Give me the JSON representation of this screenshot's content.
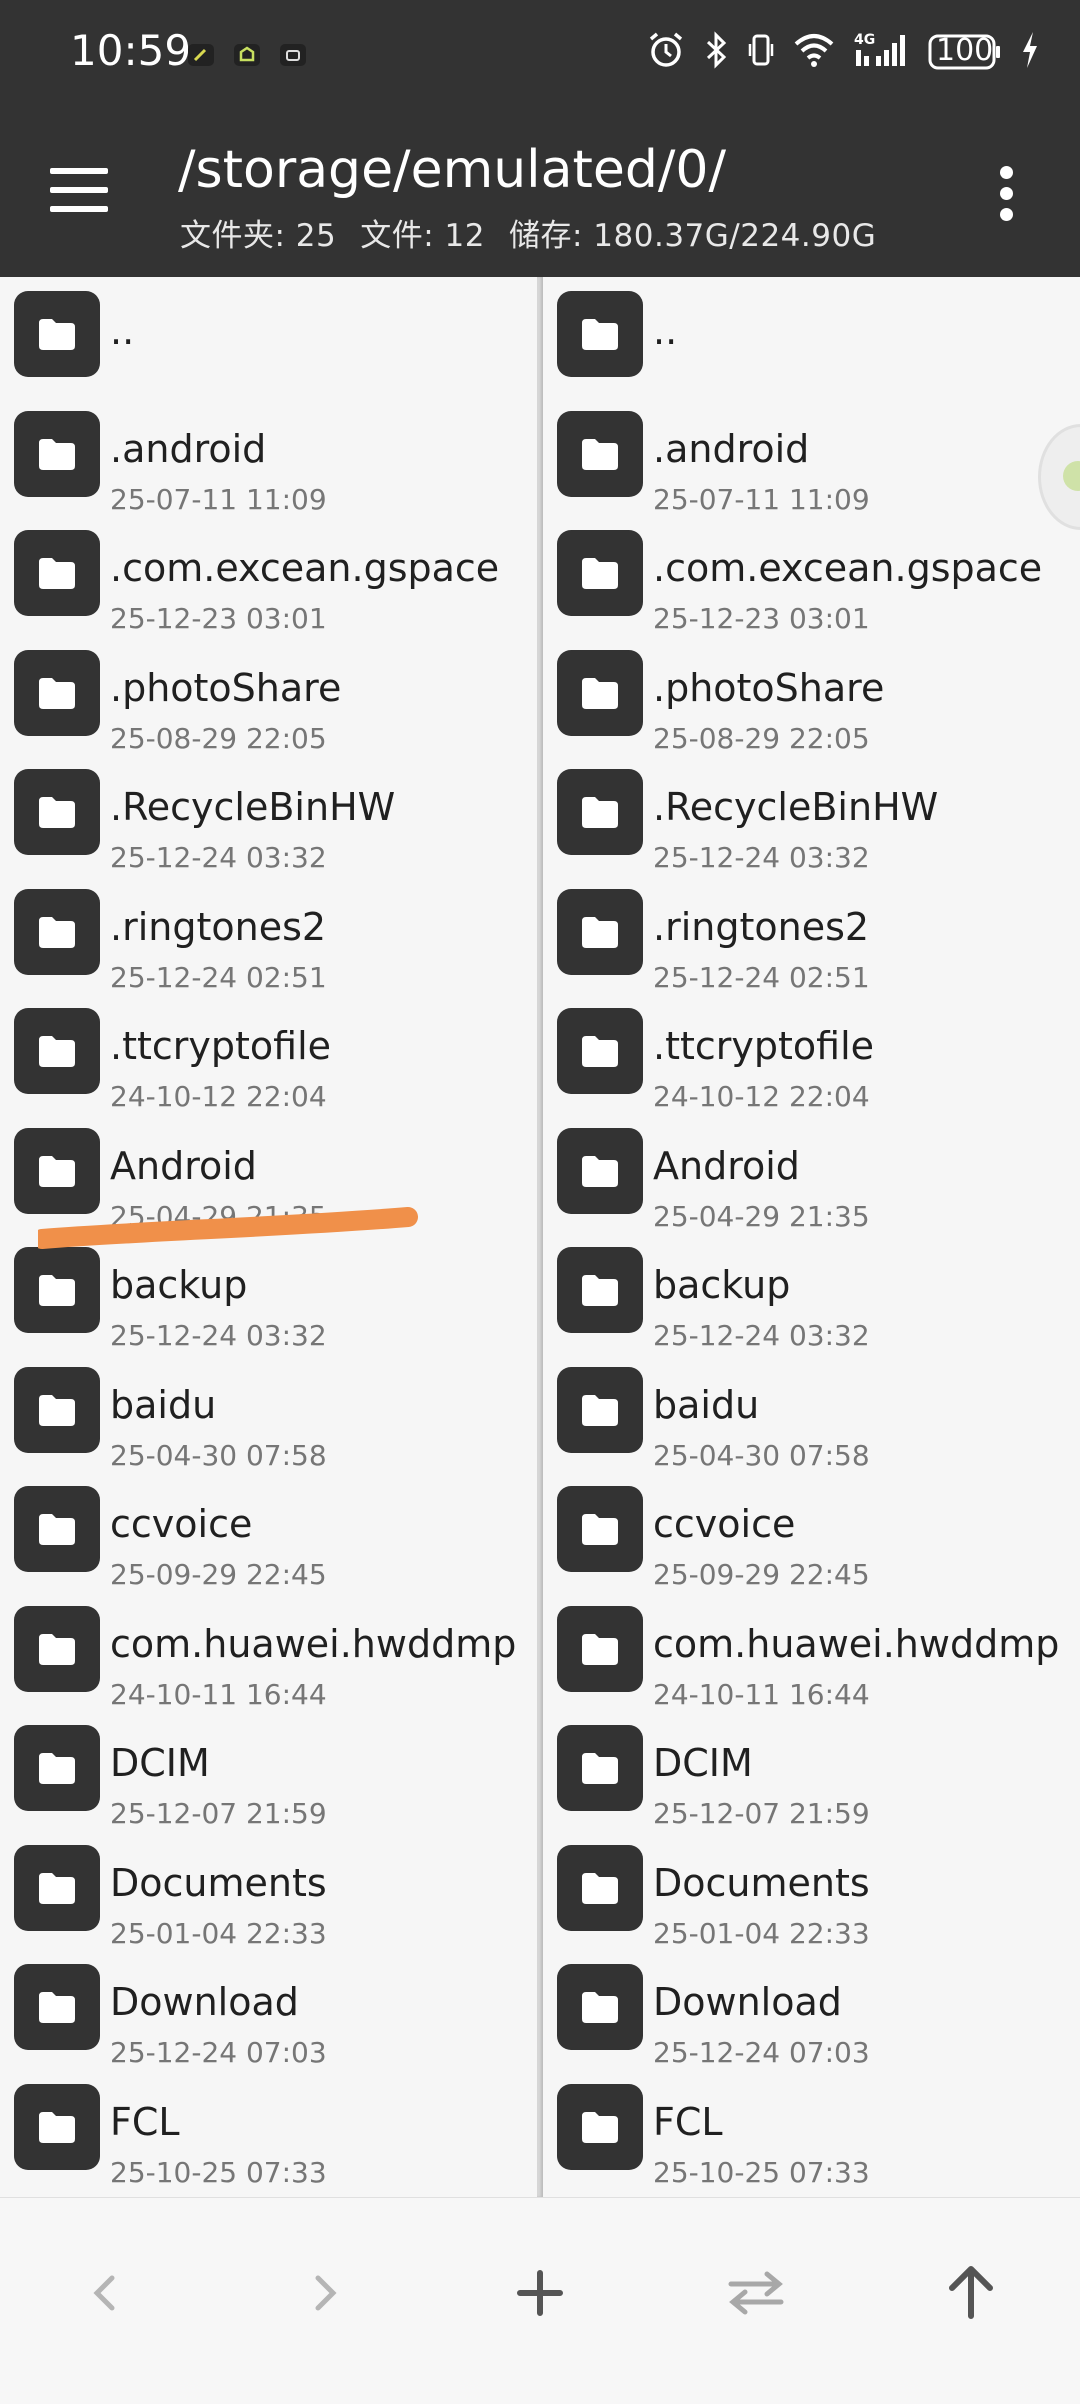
{
  "status_bar": {
    "time": "10:59",
    "battery": "100",
    "icons": [
      "usb-debug-icon",
      "android-icon",
      "robot-icon",
      "alarm-icon",
      "bluetooth-icon",
      "vibrate-icon",
      "wifi-icon",
      "signal-4g-icon",
      "battery-icon",
      "charging-icon"
    ]
  },
  "header": {
    "path": "/storage/emulated/0/",
    "stats": {
      "folders": "文件夹: 25",
      "files": "文件: 12",
      "storage": "储存: 180.37G/224.90G"
    }
  },
  "panes": {
    "left": {
      "items": [
        {
          "name": "..",
          "date": ""
        },
        {
          "name": ".android",
          "date": "25-07-11 11:09"
        },
        {
          "name": ".com.excean.gspace",
          "date": "25-12-23 03:01"
        },
        {
          "name": ".photoShare",
          "date": "25-08-29 22:05"
        },
        {
          "name": ".RecycleBinHW",
          "date": "25-12-24 03:32"
        },
        {
          "name": ".ringtones2",
          "date": "25-12-24 02:51"
        },
        {
          "name": ".ttcryptofile",
          "date": "24-10-12 22:04"
        },
        {
          "name": "Android",
          "date": "25-04-29 21:35"
        },
        {
          "name": "backup",
          "date": "25-12-24 03:32"
        },
        {
          "name": "baidu",
          "date": "25-04-30 07:58"
        },
        {
          "name": "ccvoice",
          "date": "25-09-29 22:45"
        },
        {
          "name": "com.huawei.hwddmp",
          "date": "24-10-11 16:44"
        },
        {
          "name": "DCIM",
          "date": "25-12-07 21:59"
        },
        {
          "name": "Documents",
          "date": "25-01-04 22:33"
        },
        {
          "name": "Download",
          "date": "25-12-24 07:03"
        },
        {
          "name": "FCL",
          "date": "25-10-25 07:33"
        }
      ]
    },
    "right": {
      "items": [
        {
          "name": "..",
          "date": ""
        },
        {
          "name": ".android",
          "date": "25-07-11 11:09"
        },
        {
          "name": ".com.excean.gspace",
          "date": "25-12-23 03:01"
        },
        {
          "name": ".photoShare",
          "date": "25-08-29 22:05"
        },
        {
          "name": ".RecycleBinHW",
          "date": "25-12-24 03:32"
        },
        {
          "name": ".ringtones2",
          "date": "25-12-24 02:51"
        },
        {
          "name": ".ttcryptofile",
          "date": "24-10-12 22:04"
        },
        {
          "name": "Android",
          "date": "25-04-29 21:35"
        },
        {
          "name": "backup",
          "date": "25-12-24 03:32"
        },
        {
          "name": "baidu",
          "date": "25-04-30 07:58"
        },
        {
          "name": "ccvoice",
          "date": "25-09-29 22:45"
        },
        {
          "name": "com.huawei.hwddmp",
          "date": "24-10-11 16:44"
        },
        {
          "name": "DCIM",
          "date": "25-12-07 21:59"
        },
        {
          "name": "Documents",
          "date": "25-01-04 22:33"
        },
        {
          "name": "Download",
          "date": "25-12-24 07:03"
        },
        {
          "name": "FCL",
          "date": "25-10-25 07:33"
        }
      ]
    }
  },
  "toolbar": {
    "buttons": [
      "back-icon",
      "forward-icon",
      "add-icon",
      "swap-panes-icon",
      "parent-directory-icon"
    ]
  },
  "colors": {
    "header_bg": "#333333",
    "folder_tile": "#333333",
    "annotation_stroke": "#f0904a"
  }
}
